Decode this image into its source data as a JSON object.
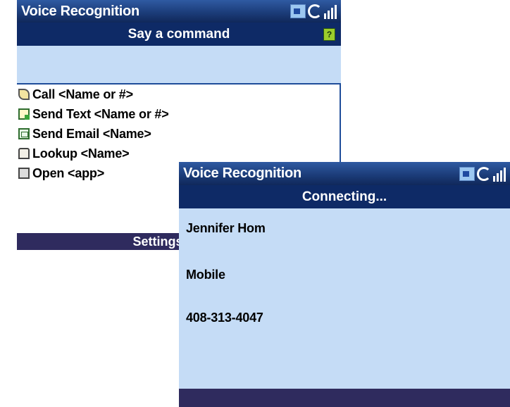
{
  "screen1": {
    "title": "Voice Recognition",
    "command_header": "Say a command",
    "help_icon": "?",
    "icons": [
      "speaker-icon",
      "sync-icon",
      "signal-icon"
    ],
    "commands": [
      {
        "icon": "phone-icon",
        "label": "Call <Name or #>"
      },
      {
        "icon": "send-text-icon",
        "label": "Send Text <Name or #>"
      },
      {
        "icon": "send-email-icon",
        "label": "Send Email <Name>"
      },
      {
        "icon": "book-icon",
        "label": "Lookup <Name>"
      },
      {
        "icon": "app-icon",
        "label": "Open <app>"
      }
    ],
    "softkey": "Settings"
  },
  "screen2": {
    "title": "Voice Recognition",
    "status": "Connecting...",
    "contact_name": "Jennifer Hom",
    "phone_type": "Mobile",
    "phone_number": "408-313-4047"
  },
  "colors": {
    "title_bar": "#1c3d7a",
    "command_bar": "#0e2a66",
    "band": "#c5dcf6",
    "softkey_bar": "#2f2b5e"
  }
}
